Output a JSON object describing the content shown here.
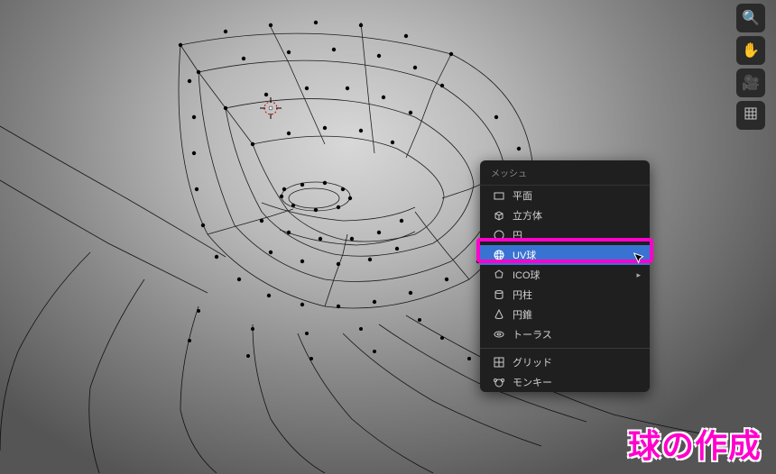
{
  "menu": {
    "header": "メッシュ",
    "items": [
      {
        "label": "平面",
        "icon": "plane"
      },
      {
        "label": "立方体",
        "icon": "cube"
      },
      {
        "label": "円",
        "icon": "circle"
      },
      {
        "label": "UV球",
        "icon": "uvsphere",
        "highlighted": true
      },
      {
        "label": "ICO球",
        "icon": "icosphere",
        "submenu": true
      },
      {
        "label": "円柱",
        "icon": "cylinder"
      },
      {
        "label": "円錐",
        "icon": "cone"
      },
      {
        "label": "トーラス",
        "icon": "torus"
      }
    ],
    "items2": [
      {
        "label": "グリッド",
        "icon": "grid"
      },
      {
        "label": "モンキー",
        "icon": "monkey"
      }
    ]
  },
  "caption": "球の作成",
  "nav": {
    "zoom": "zoom",
    "pan": "pan",
    "camera": "camera",
    "perspective": "perspective"
  }
}
